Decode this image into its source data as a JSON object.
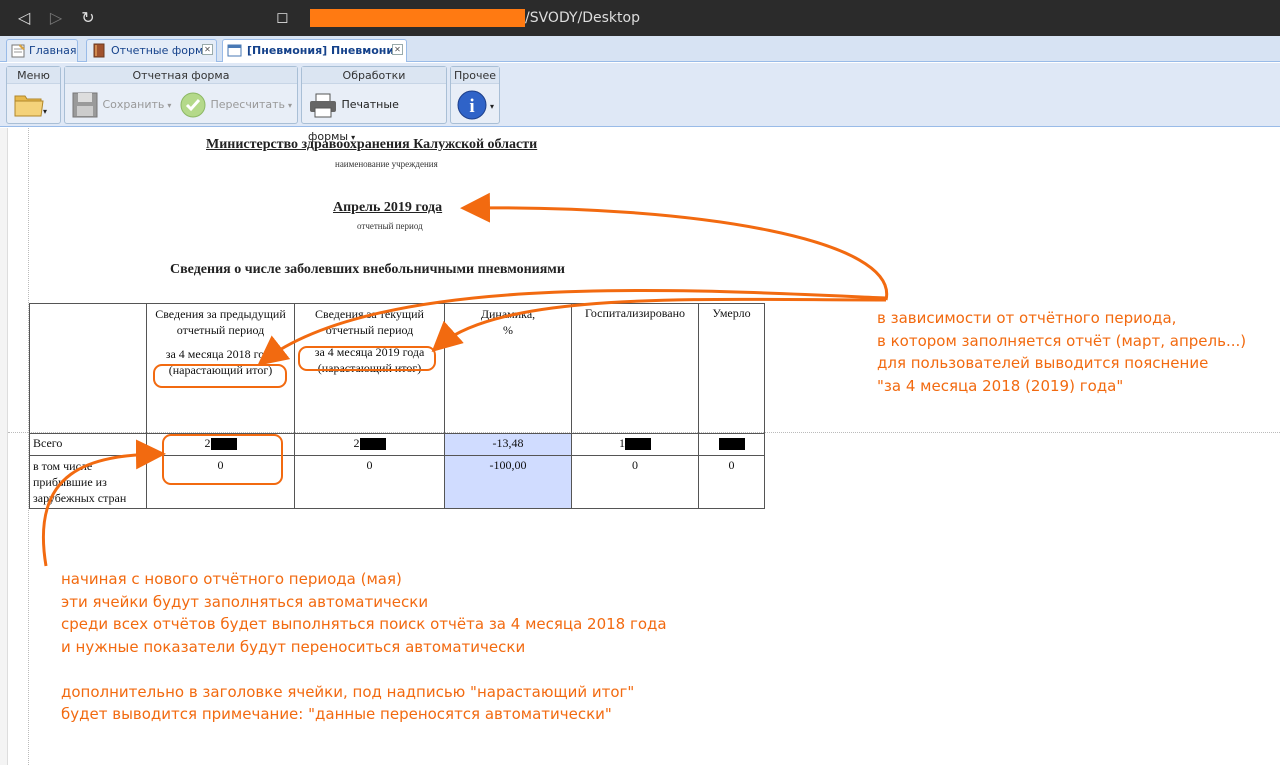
{
  "browser": {
    "url_path": "/SVODY/Desktop"
  },
  "tabs": [
    {
      "label": "Главная"
    },
    {
      "label": "Отчетные формы"
    },
    {
      "label": "[Пневмония] Пневмония"
    }
  ],
  "toolbar": {
    "menu_title": "Меню",
    "form_title": "Отчетная форма",
    "save_label": "Сохранить",
    "recalc_label": "Пересчитать",
    "processing_title": "Обработки",
    "print_label": "Печатные формы",
    "other_title": "Прочее"
  },
  "report": {
    "org": "Министерство здравоохранения Калужской области",
    "org_sub": "наименование учреждения",
    "period": "Апрель 2019 года",
    "period_sub": "отчетный период",
    "heading": "Сведения о числе заболевших внебольничными пневмониями"
  },
  "table": {
    "headers": {
      "prev": "Сведения за предыдущий отчетный период",
      "prev_note": "за 4 месяца 2018 года",
      "prev_note2": "(нарастающий итог)",
      "cur": "Сведения за текущий отчетный период",
      "cur_note": "за 4 месяца 2019 года",
      "cur_note2": "(нарастающий итог)",
      "dyn": "Динамика,",
      "dyn_unit": "%",
      "hosp": "Госпитализировано",
      "died": "Умерло"
    },
    "rows": [
      {
        "label": "Всего",
        "prev": "2",
        "cur": "2",
        "dyn": "-13,48",
        "hosp": "1",
        "died": ""
      },
      {
        "label": "в том числе прибывшие из зарубежных стран",
        "prev": "0",
        "cur": "0",
        "dyn": "-100,00",
        "hosp": "0",
        "died": "0"
      }
    ]
  },
  "annotations": {
    "right": "в зависимости от отчётного периода,\nв котором заполняется отчёт (март, апрель...)\nдля пользователей выводится пояснение\n\"за 4 месяца 2018 (2019) года\"",
    "bottom": "начиная с нового отчётного периода (мая)\nэти ячейки будут заполняться автоматически\nсреди всех отчётов будет выполняться поиск отчёта за 4 месяца 2018 года\nи нужные показатели будут переноситься автоматически\n\nдополнительно в заголовке ячейки, под надписью \"нарастающий итог\"\nбудет выводится примечание: \"данные переносятся автоматически\""
  },
  "colors": {
    "annotation": "#f26a10",
    "highlight_cell": "#d0dcff"
  }
}
